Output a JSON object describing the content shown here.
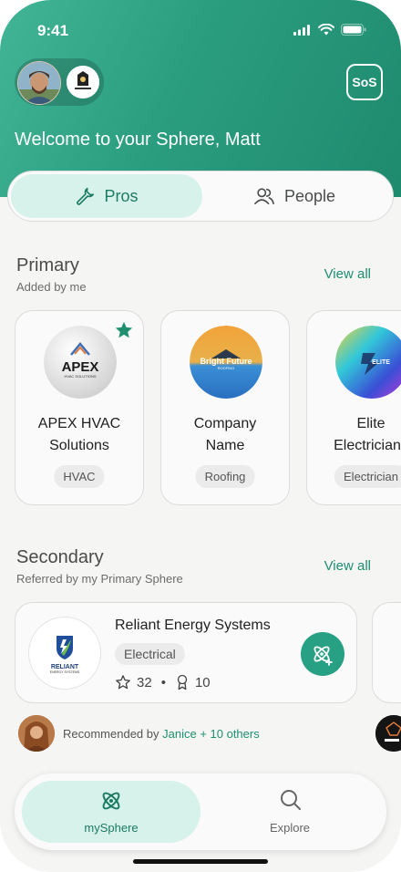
{
  "status": {
    "time": "9:41"
  },
  "header": {
    "sos_label": "SoS",
    "welcome": "Welcome to your Sphere, Matt",
    "tabs": {
      "pros": "Pros",
      "people": "People"
    }
  },
  "primary": {
    "title": "Primary",
    "subtitle": "Added by me",
    "view_all": "View all",
    "cards": [
      {
        "name": "APEX HVAC Solutions",
        "tag": "HVAC",
        "logo_text": "APEX",
        "logo_sub": "HVAC SOLUTIONS",
        "favorite": true
      },
      {
        "name": "Company Name",
        "tag": "Roofing",
        "logo_text": "Bright Future",
        "logo_sub": "ROOFING"
      },
      {
        "name": "Elite Electricians",
        "tag": "Electrician",
        "logo_text": "ELITE"
      }
    ]
  },
  "secondary": {
    "title": "Secondary",
    "subtitle": "Referred by my Primary Sphere",
    "view_all": "View all",
    "card": {
      "name": "Reliant Energy Systems",
      "tag": "Electrical",
      "stars": "32",
      "badges": "10",
      "logo_text": "RELIANT",
      "logo_sub": "ENERGY SYSTEMS"
    },
    "recommended_prefix": "Recommended by",
    "recommended_names": "Janice + 10 others"
  },
  "tabbar": {
    "my_sphere": "mySphere",
    "explore": "Explore"
  },
  "colors": {
    "brand": "#27a083",
    "brand_dark": "#1d7b64",
    "brand_light": "#d6f2ea"
  }
}
